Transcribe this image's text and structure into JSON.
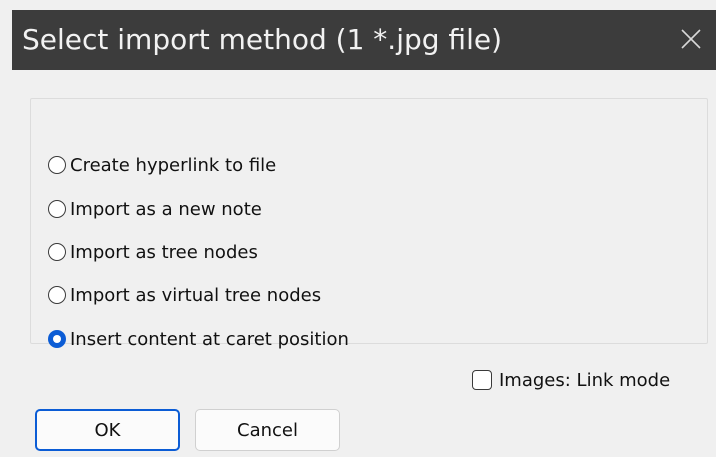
{
  "window": {
    "title": "Select import method (1 *.jpg file)",
    "close_icon": "close-icon"
  },
  "options": {
    "items": [
      {
        "label": "Create hyperlink to file",
        "checked": false
      },
      {
        "label": "Import as a new note",
        "checked": false
      },
      {
        "label": "Import as tree nodes",
        "checked": false
      },
      {
        "label": "Import as virtual tree nodes",
        "checked": false
      },
      {
        "label": "Insert content at caret position",
        "checked": true
      }
    ]
  },
  "images_link_mode": {
    "label": "Images: Link mode",
    "checked": false
  },
  "buttons": {
    "ok_label": "OK",
    "cancel_label": "Cancel"
  },
  "colors": {
    "titlebar": "#3c3c3c",
    "accent": "#0b5cd5",
    "background": "#f0f0f0"
  }
}
